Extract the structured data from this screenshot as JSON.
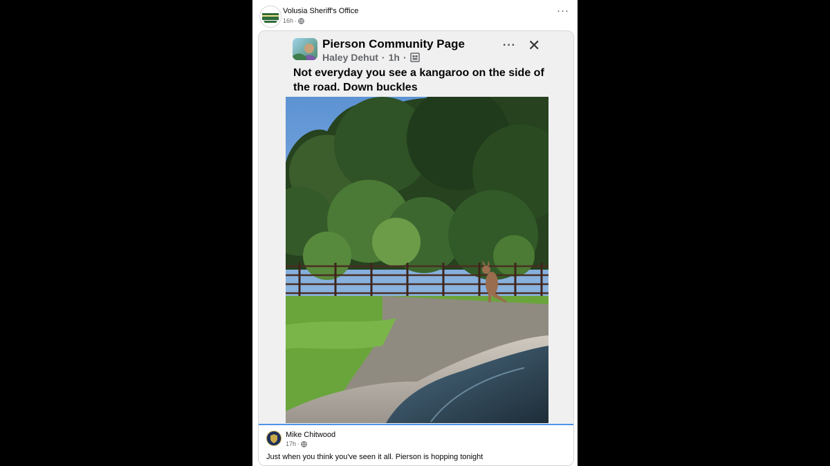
{
  "post": {
    "page_name": "Volusia Sheriff's Office",
    "time": "16h",
    "separator": "·",
    "audience_icon": "globe-icon",
    "more_icon": "more-icon",
    "more_label": "···"
  },
  "shared": {
    "group_name": "Pierson Community Page",
    "author": "Haley Dehut",
    "time": "1h",
    "separator": "·",
    "audience_icon": "group-icon",
    "more_label": "···",
    "close_label": "✕",
    "text": "Not everyday you see a kangaroo on the side of the road. Down buckles"
  },
  "comment": {
    "author": "Mike Chitwood",
    "time": "17h",
    "separator": "·",
    "text": "Just when you think you've seen it all. Pierson is hopping tonight"
  },
  "colors": {
    "link_blue": "#4f93e8",
    "meta_gray": "#65676b"
  }
}
